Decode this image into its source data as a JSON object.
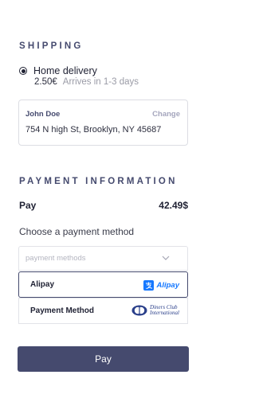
{
  "shipping": {
    "title": "SHIPPING",
    "option_label": "Home delivery",
    "price": "2.50€",
    "arrives": "Arrives in 1-3 days",
    "address": {
      "name": "John Doe",
      "change_label": "Change",
      "line": "754 N high St, Brooklyn, NY 45687"
    }
  },
  "payment": {
    "title": "PAYMENT INFORMATION",
    "pay_label": "Pay",
    "amount": "42.49$",
    "choose_label": "Choose a payment method",
    "select_placeholder": "payment methods",
    "options": [
      {
        "label": "Alipay",
        "logo_text": "Alipay",
        "icon": "alipay-logo-icon",
        "selected": true
      },
      {
        "label": "Payment Method",
        "logo_text_1": "Diners Club",
        "logo_text_2": "International",
        "icon": "diners-club-logo-icon",
        "selected": false
      }
    ],
    "button_label": "Pay"
  },
  "colors": {
    "accent": "#454a6e",
    "alipay_blue": "#1678ff",
    "diners_blue": "#2a3f8a"
  }
}
